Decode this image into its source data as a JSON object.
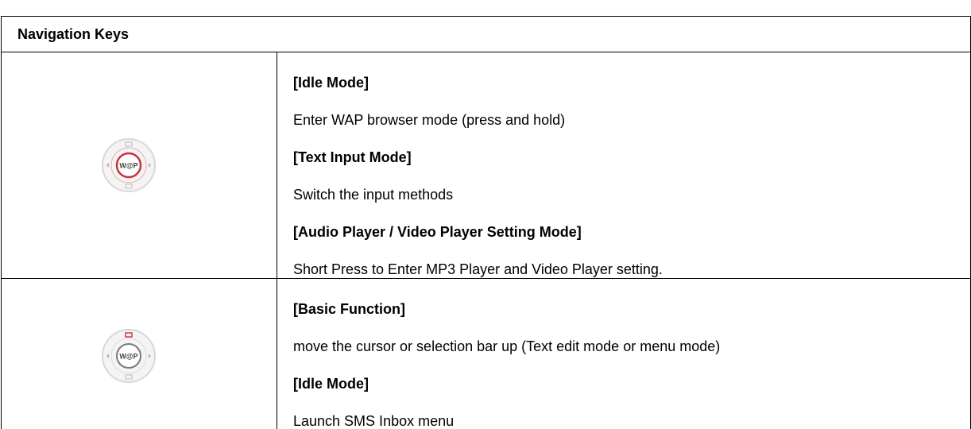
{
  "table": {
    "header": "Navigation Keys",
    "rows": [
      {
        "icon": "wap-navigation-key-icon",
        "lines": [
          {
            "text": "[Idle Mode]",
            "bold": true
          },
          {
            "text": "Enter WAP browser mode (press and hold)",
            "bold": false
          },
          {
            "text": "[Text Input Mode]",
            "bold": true
          },
          {
            "text": "Switch the input methods",
            "bold": false
          },
          {
            "text": "[Audio Player / Video Player Setting Mode]",
            "bold": true
          },
          {
            "text": "Short Press to Enter MP3 Player and Video Player setting.",
            "bold": false
          }
        ]
      },
      {
        "icon": "up-navigation-key-icon",
        "lines": [
          {
            "text": "[Basic Function]",
            "bold": true
          },
          {
            "text": "move the cursor or selection bar up (Text edit mode or menu mode)",
            "bold": false
          },
          {
            "text": "[Idle Mode]",
            "bold": true
          },
          {
            "text": "Launch SMS Inbox menu",
            "bold": false
          }
        ]
      }
    ],
    "key_label": "W@P"
  },
  "colors": {
    "border": "#000000",
    "ring_outer": "#d8d8d8",
    "ring_red": "#c8323c",
    "up_arrow_highlight": "#d23c3c"
  }
}
